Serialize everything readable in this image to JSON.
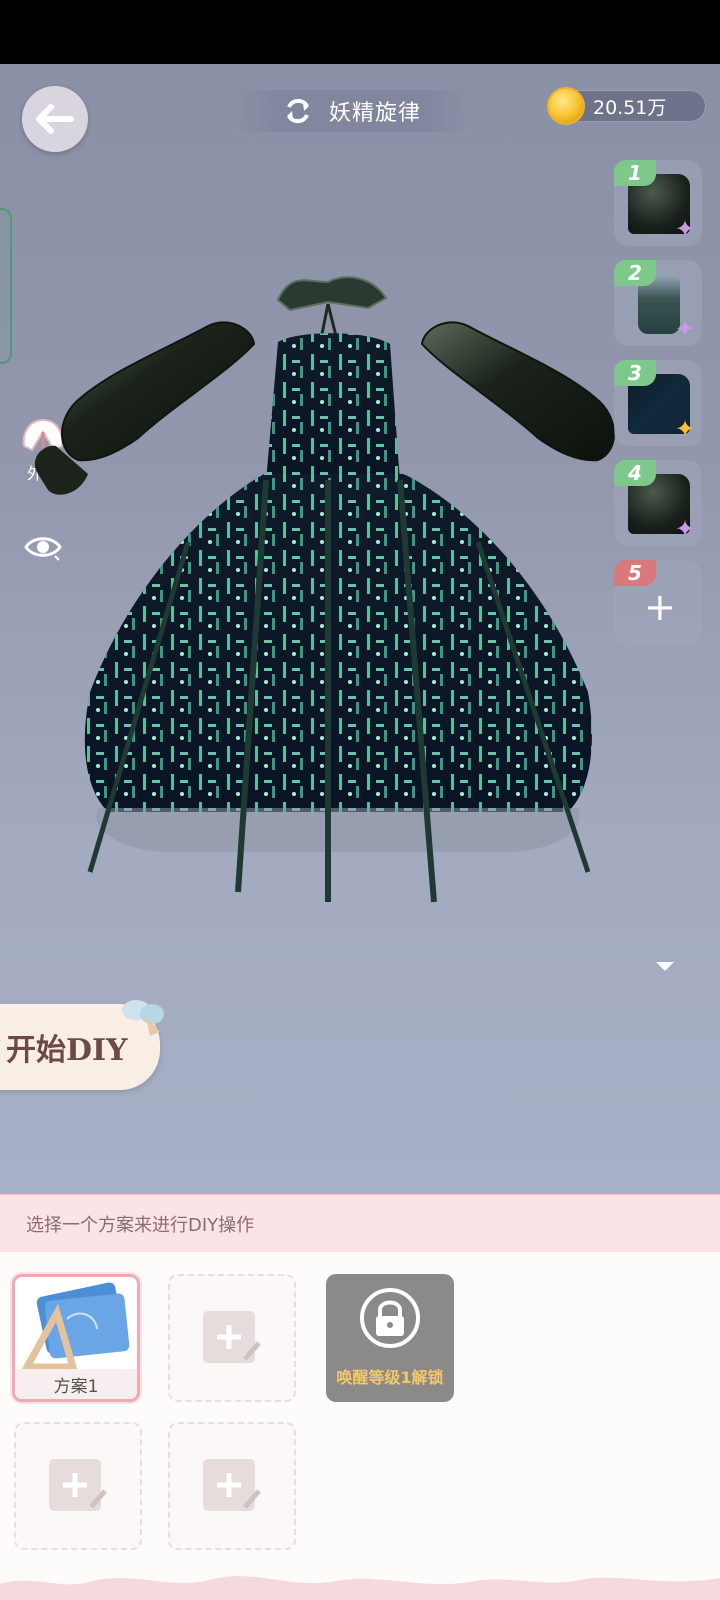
{
  "header": {
    "title": "妖精旋律",
    "coins": "20.51万",
    "back_icon": "back-arrow-icon",
    "switch_icon": "refresh-icon",
    "coin_icon": "gold-coin-icon"
  },
  "side_tools": [
    {
      "label": "外套",
      "icon": "coat-icon"
    },
    {
      "label": "",
      "icon": "eye-icon"
    }
  ],
  "slots": [
    {
      "number": "1",
      "item": "puff-sleeve",
      "rarity_icon": "purple-star-icon"
    },
    {
      "number": "2",
      "item": "bottle",
      "rarity_icon": "purple-star-icon"
    },
    {
      "number": "3",
      "item": "circuit-print",
      "rarity_icon": "gold-star-icon"
    },
    {
      "number": "4",
      "item": "puff-sleeve",
      "rarity_icon": "purple-star-icon"
    },
    {
      "number": "5",
      "item": "empty",
      "rarity_icon": ""
    }
  ],
  "diy_button": {
    "label": "开始DIY"
  },
  "panel": {
    "hint": "选择一个方案来进行DIY操作",
    "plans": [
      {
        "label": "方案1",
        "state": "selected"
      },
      {
        "label": "",
        "state": "empty"
      },
      {
        "label": "唤醒等级1解锁",
        "state": "locked"
      },
      {
        "label": "",
        "state": "empty"
      },
      {
        "label": "",
        "state": "empty"
      }
    ]
  },
  "colors": {
    "accent_pink": "#f1aab2",
    "slot_green": "#7ec88b",
    "slot_red": "#d9797b",
    "lock_gold": "#f3c76b",
    "dress_glow": "#5fe0b3"
  }
}
